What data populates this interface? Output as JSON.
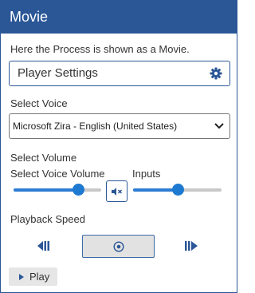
{
  "header": {
    "title": "Movie"
  },
  "description": "Here the Process is shown as a Movie.",
  "player_settings": {
    "label": "Player Settings",
    "icon": "gear-icon"
  },
  "voice": {
    "label": "Select Voice",
    "selected": "Microsoft Zira - English (United States)"
  },
  "volume": {
    "label": "Select Volume",
    "voice_volume_label": "Select Voice Volume",
    "inputs_label": "Inputs",
    "voice_volume_level": 0.74,
    "inputs_level": 0.5,
    "mute_icon": "speaker-mute-icon"
  },
  "playback": {
    "label": "Playback Speed",
    "slower_icon": "step-back-icon",
    "normal_icon": "target-circle-icon",
    "faster_icon": "step-forward-icon"
  },
  "play_button": {
    "label": "Play",
    "icon": "play-icon"
  },
  "colors": {
    "header": "#2b5797",
    "accent": "#1e7ad1",
    "track": "#c8c8c8"
  }
}
